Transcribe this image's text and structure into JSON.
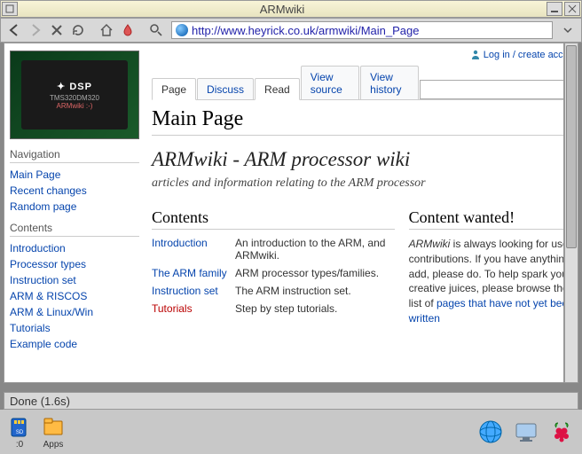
{
  "window": {
    "title": "ARMwiki"
  },
  "url": "http://www.heyrick.co.uk/armwiki/Main_Page",
  "auth": {
    "login": "Log in / create account"
  },
  "tabs": {
    "page": "Page",
    "discuss": "Discuss",
    "read": "Read",
    "viewsource": "View source",
    "viewhistory": "View history"
  },
  "page": {
    "title": "Main Page",
    "headline": "ARMwiki - ARM processor wiki",
    "subhead": "articles and information relating to the ARM processor"
  },
  "sidebar": {
    "nav_head": "Navigation",
    "nav": [
      "Main Page",
      "Recent changes",
      "Random page"
    ],
    "con_head": "Contents",
    "con": [
      "Introduction",
      "Processor types",
      "Instruction set",
      "ARM & RISCOS",
      "ARM & Linux/Win",
      "Tutorials",
      "Example code"
    ]
  },
  "contents": {
    "head": "Contents",
    "rows": [
      {
        "k": "Introduction",
        "d": "An introduction to the ARM, and ARMwiki."
      },
      {
        "k": "The ARM family",
        "d": "ARM processor types/families."
      },
      {
        "k": "Instruction set",
        "d": "The ARM instruction set."
      },
      {
        "k": "Tutorials",
        "d": "Step by step tutorials.",
        "red": true
      }
    ]
  },
  "wanted": {
    "head": "Content wanted!",
    "body_em": "ARMwiki",
    "body": " is always looking for user contributions. If you have anything to add, please do. To help spark your creative juices, please browse the list of ",
    "link": "pages that have not yet been written"
  },
  "chip": {
    "dsp": "DSP",
    "model": "TMS320DM320",
    "arm": "ARMwiki    :-)"
  },
  "status": "Done (1.6s)",
  "tray": {
    "sd": ":0",
    "apps": "Apps"
  }
}
